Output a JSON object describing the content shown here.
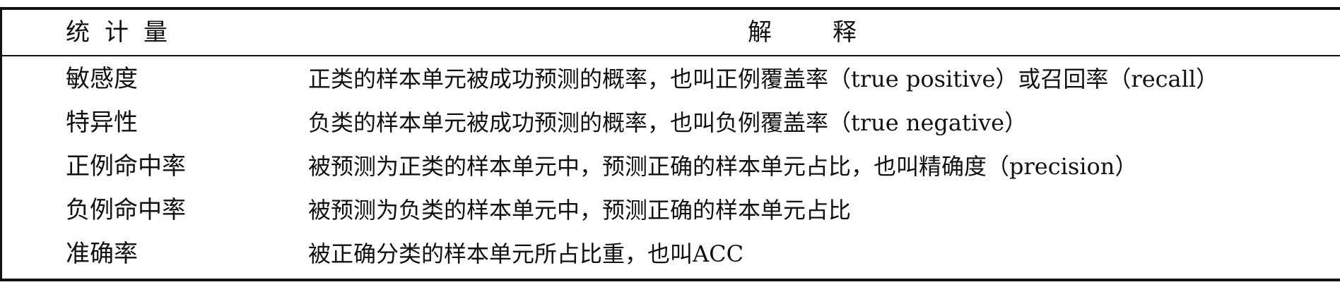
{
  "table": {
    "headers": {
      "statistic": "统计量",
      "explanation": "解释"
    },
    "rows": [
      {
        "statistic": "敏感度",
        "explanation": "正类的样本单元被成功预测的概率，也叫正例覆盖率（true positive）或召回率（recall）"
      },
      {
        "statistic": "特异性",
        "explanation": "负类的样本单元被成功预测的概率，也叫负例覆盖率（true negative）"
      },
      {
        "statistic": "正例命中率",
        "explanation": "被预测为正类的样本单元中，预测正确的样本单元占比，也叫精确度（precision）"
      },
      {
        "statistic": "负例命中率",
        "explanation": "被预测为负类的样本单元中，预测正确的样本单元占比"
      },
      {
        "statistic": "准确率",
        "explanation": "被正确分类的样本单元所占比重，也叫ACC"
      }
    ]
  }
}
